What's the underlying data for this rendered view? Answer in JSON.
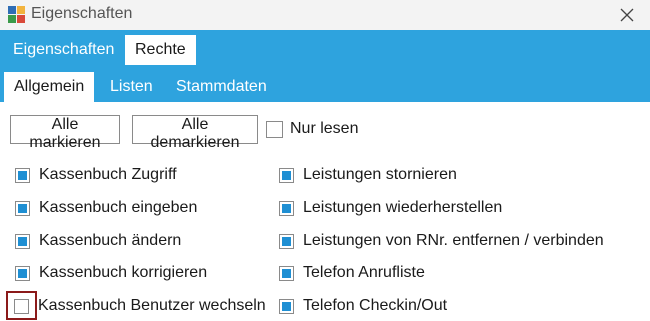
{
  "window": {
    "title": "Eigenschaften",
    "app_icon": "app-logo-icon",
    "close_icon": "close-icon"
  },
  "colors": {
    "ribbon": "#2ea3de",
    "checkbox_fill": "#1f8fd3",
    "focus_ring": "#8b1a1a"
  },
  "tabs": [
    {
      "label": "Eigenschaften",
      "active": false
    },
    {
      "label": "Rechte",
      "active": true
    }
  ],
  "subtabs": [
    {
      "label": "Allgemein",
      "active": true
    },
    {
      "label": "Listen",
      "active": false
    },
    {
      "label": "Stammdaten",
      "active": false
    }
  ],
  "toolbar": {
    "select_all": "Alle markieren",
    "deselect_all": "Alle demarkieren",
    "readonly_label": "Nur lesen",
    "readonly_checked": false
  },
  "permissions": {
    "left": [
      {
        "label": "Kassenbuch Zugriff",
        "checked": true
      },
      {
        "label": "Kassenbuch eingeben",
        "checked": true
      },
      {
        "label": "Kassenbuch ändern",
        "checked": true
      },
      {
        "label": "Kassenbuch korrigieren",
        "checked": true
      },
      {
        "label": "Kassenbuch Benutzer wechseln",
        "checked": false,
        "focused": true
      }
    ],
    "right": [
      {
        "label": "Leistungen stornieren",
        "checked": true
      },
      {
        "label": "Leistungen wiederherstellen",
        "checked": true
      },
      {
        "label": "Leistungen von RNr. entfernen / verbinden",
        "checked": true
      },
      {
        "label": "Telefon Anrufliste",
        "checked": true
      },
      {
        "label": "Telefon Checkin/Out",
        "checked": true
      }
    ]
  }
}
